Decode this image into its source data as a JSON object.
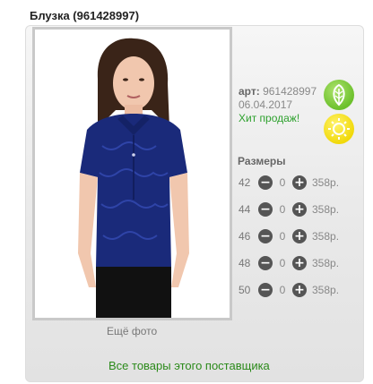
{
  "title": "Блузка (961428997)",
  "info": {
    "art_label": "арт:",
    "art_value": "961428997",
    "date": "06.04.2017",
    "hit": "Хит продаж!"
  },
  "badges": {
    "top_icon": "leaf-icon",
    "bottom_icon": "sun-icon"
  },
  "more_photo": "Ещё фото",
  "sizes": {
    "title": "Размеры",
    "rows": [
      {
        "size": "42",
        "qty": "0",
        "price": "358р."
      },
      {
        "size": "44",
        "qty": "0",
        "price": "358р."
      },
      {
        "size": "46",
        "qty": "0",
        "price": "358р."
      },
      {
        "size": "48",
        "qty": "0",
        "price": "358р."
      },
      {
        "size": "50",
        "qty": "0",
        "price": "358р."
      }
    ],
    "minus": "−",
    "plus": "+"
  },
  "supplier_link": "Все товары этого поставщика",
  "colors": {
    "link_green": "#2b8a1a",
    "blouse_navy": "#1a2a7a",
    "leaf_green": "#6cc02c",
    "sun_yellow": "#f1d90b"
  }
}
